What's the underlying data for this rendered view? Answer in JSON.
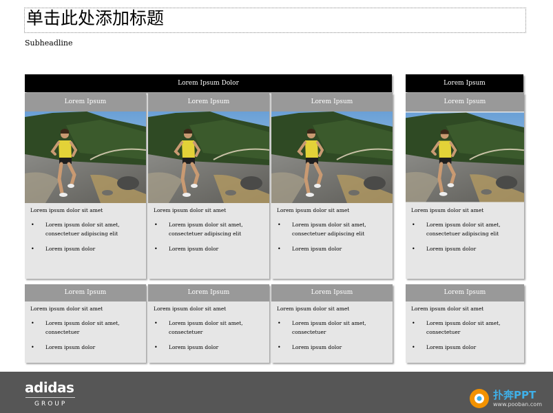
{
  "slide": {
    "title": "单击此处添加标题",
    "subheadline": "Subheadline"
  },
  "groups": [
    {
      "header": "Lorem Ipsum Dolor"
    },
    {
      "header": "Lorem Ipsum"
    }
  ],
  "cards": [
    {
      "header": "Lorem Ipsum",
      "lead": "Lorem ipsum dolor sit amet",
      "bullets": [
        "Lorem ipsum dolor sit amet, consectetuer adipiscing elit",
        "Lorem ipsum dolor"
      ]
    },
    {
      "header": "Lorem Ipsum",
      "lead": "Lorem ipsum dolor sit amet",
      "bullets": [
        "Lorem ipsum dolor sit amet, consectetuer adipiscing elit",
        "Lorem ipsum dolor"
      ]
    },
    {
      "header": "Lorem Ipsum",
      "lead": "Lorem ipsum dolor sit amet",
      "bullets": [
        "Lorem ipsum dolor sit amet, consectetuer adipiscing elit",
        "Lorem ipsum dolor"
      ]
    },
    {
      "header": "Lorem Ipsum",
      "lead": "Lorem ipsum dolor sit amet",
      "bullets": [
        "Lorem ipsum dolor sit amet, consectetuer adipiscing elit",
        "Lorem ipsum dolor"
      ]
    },
    {
      "header": "Lorem Ipsum",
      "lead": "Lorem ipsum dolor sit amet",
      "bullets": [
        "Lorem ipsum dolor sit amet, consectetuer",
        "Lorem ipsum dolor"
      ]
    },
    {
      "header": "Lorem Ipsum",
      "lead": "Lorem ipsum dolor sit amet",
      "bullets": [
        "Lorem ipsum dolor sit amet, consectetuer",
        "Lorem ipsum dolor"
      ]
    },
    {
      "header": "Lorem Ipsum",
      "lead": "Lorem ipsum dolor sit amet",
      "bullets": [
        "Lorem ipsum dolor sit amet, consectetuer",
        "Lorem ipsum dolor"
      ]
    },
    {
      "header": "Lorem Ipsum",
      "lead": "Lorem ipsum dolor sit amet",
      "bullets": [
        "Lorem ipsum dolor sit amet, consectetuer",
        "Lorem ipsum dolor"
      ]
    }
  ],
  "footer": {
    "logo_word": "adidas",
    "logo_group": "GROUP",
    "watermark_brand": "扑奔PPT",
    "watermark_url": "www.pooban.com"
  },
  "colors": {
    "group_header_bg": "#000000",
    "card_header_bg": "#999999",
    "card_body_bg": "#e6e6e6",
    "footer_bg": "#565656",
    "watermark_blue": "#3fb0e8",
    "watermark_orange": "#f39200"
  },
  "icons": {
    "photo": "runner-photo",
    "bullet": "bullet-dot",
    "brand": "adidas-logo",
    "watermark": "pooban-logo"
  }
}
